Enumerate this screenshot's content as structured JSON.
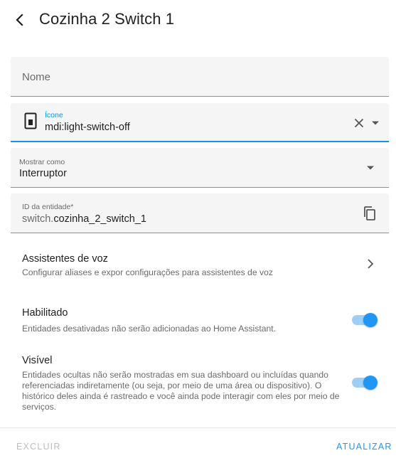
{
  "header": {
    "title": "Cozinha 2 Switch 1"
  },
  "form": {
    "name_label": "Nome",
    "icon_label": "Ícone",
    "icon_value": "mdi:light-switch-off",
    "show_as_label": "Mostrar como",
    "show_as_value": "Interruptor",
    "entity_id_label": "ID da entidade*",
    "entity_id_domain": "switch.",
    "entity_id_object": "cozinha_2_switch_1"
  },
  "voice": {
    "title": "Assistentes de voz",
    "description": "Configurar aliases e expor configurações para assistentes de voz"
  },
  "enabled": {
    "title": "Habilitado",
    "description": "Entidades desativadas não serão adicionadas ao Home Assistant.",
    "checked": true
  },
  "visible": {
    "title": "Visível",
    "description": "Entidades ocultas não serão mostradas em sua dashboard ou incluídas quando referenciadas indiretamente (ou seja, por meio de uma área ou dispositivo). O histórico deles ainda é rastreado e você ainda pode interagir com eles por meio de serviços.",
    "checked": true
  },
  "footer": {
    "delete_label": "EXCLUIR",
    "update_label": "ATUALIZAR"
  },
  "icons": {
    "back": "arrow-left-icon",
    "entity_icon": "light-switch-off-icon",
    "clear": "close-icon",
    "dropdown": "menu-down-icon",
    "copy": "content-copy-icon",
    "chevron": "chevron-right-icon"
  },
  "colors": {
    "accent": "#2196f3",
    "focus": "#039be5",
    "field_background": "#f5f5f5",
    "toggle_track": "#9ccef6"
  }
}
